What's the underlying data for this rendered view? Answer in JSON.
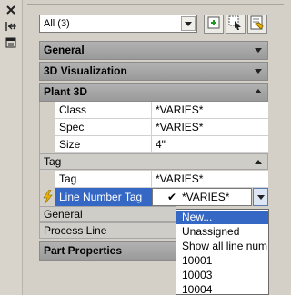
{
  "selection": {
    "value": "All (3)"
  },
  "sections": {
    "general": "General",
    "visualization": "3D Visualization",
    "plant3d": "Plant 3D",
    "tag": "Tag",
    "general2": "General",
    "process_line": "Process Line",
    "part_properties": "Part Properties"
  },
  "plant3d_rows": [
    {
      "key": "Class",
      "value": "*VARIES*"
    },
    {
      "key": "Spec",
      "value": "*VARIES*"
    },
    {
      "key": "Size",
      "value": "4\""
    }
  ],
  "tag_rows": [
    {
      "key": "Tag",
      "value": "*VARIES*"
    },
    {
      "key": "Line Number Tag",
      "value": "*VARIES*"
    }
  ],
  "dropdown": {
    "items": [
      "New...",
      "Unassigned",
      "Show all line num",
      "10001",
      "10003",
      "10004"
    ],
    "selected": "New..."
  },
  "icons": {
    "close": "close-icon",
    "autohide": "auto-hide-icon",
    "properties": "properties-icon",
    "quick_select": "quick-select-icon",
    "select_objects": "select-objects-icon",
    "toggle_pickadd": "toggle-pickadd-icon",
    "lightning": "lightning-icon"
  },
  "colors": {
    "highlight": "#3468c4",
    "lightning": "#e8b400"
  }
}
